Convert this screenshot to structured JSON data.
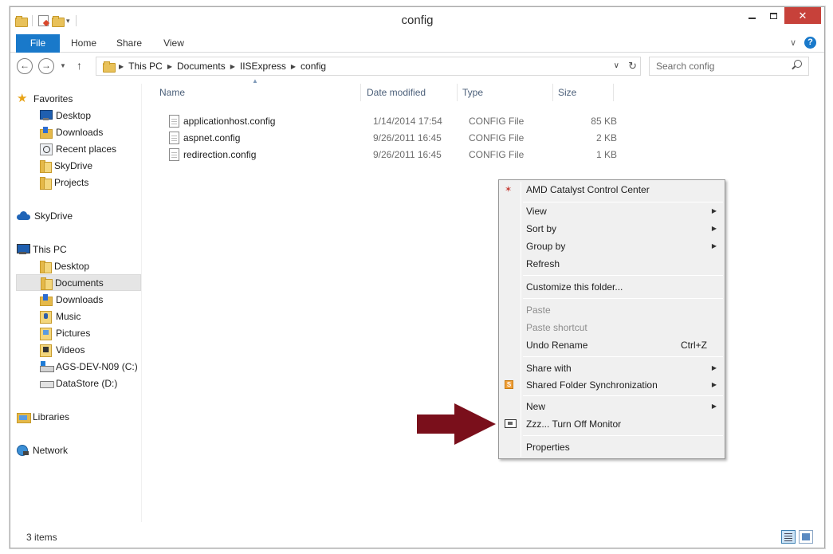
{
  "window": {
    "title": "config"
  },
  "ribbon": {
    "tabs": [
      {
        "label": "File"
      },
      {
        "label": "Home"
      },
      {
        "label": "Share"
      },
      {
        "label": "View"
      }
    ]
  },
  "address": {
    "crumbs": [
      "This PC",
      "Documents",
      "IISExpress",
      "config"
    ]
  },
  "search": {
    "placeholder": "Search config"
  },
  "navpane": {
    "favorites_label": "Favorites",
    "favorites": [
      "Desktop",
      "Downloads",
      "Recent places",
      "SkyDrive",
      "Projects"
    ],
    "skydrive_label": "SkyDrive",
    "thispc_label": "This PC",
    "thispc": [
      "Desktop",
      "Documents",
      "Downloads",
      "Music",
      "Pictures",
      "Videos",
      "AGS-DEV-N09 (C:)",
      "DataStore (D:)"
    ],
    "libraries_label": "Libraries",
    "network_label": "Network",
    "selected": "Documents"
  },
  "columns": {
    "name": "Name",
    "date": "Date modified",
    "type": "Type",
    "size": "Size"
  },
  "files": [
    {
      "name": "applicationhost.config",
      "date": "1/14/2014 17:54",
      "type": "CONFIG File",
      "size": "85 KB"
    },
    {
      "name": "aspnet.config",
      "date": "9/26/2011 16:45",
      "type": "CONFIG File",
      "size": "2 KB"
    },
    {
      "name": "redirection.config",
      "date": "9/26/2011 16:45",
      "type": "CONFIG File",
      "size": "1 KB"
    }
  ],
  "context_menu": {
    "amd": "AMD Catalyst Control Center",
    "view": "View",
    "sort_by": "Sort by",
    "group_by": "Group by",
    "refresh": "Refresh",
    "customize": "Customize this folder...",
    "paste": "Paste",
    "paste_shortcut": "Paste shortcut",
    "undo_rename": "Undo Rename",
    "undo_shortcut": "Ctrl+Z",
    "share_with": "Share with",
    "shared_sync": "Shared Folder Synchronization",
    "new": "New",
    "turn_off_monitor": "Zzz... Turn Off Monitor",
    "properties": "Properties"
  },
  "status": {
    "items": "3 items"
  },
  "colors": {
    "accent": "#1979ca",
    "close": "#c7413a",
    "arrow": "#7a0f1b"
  }
}
